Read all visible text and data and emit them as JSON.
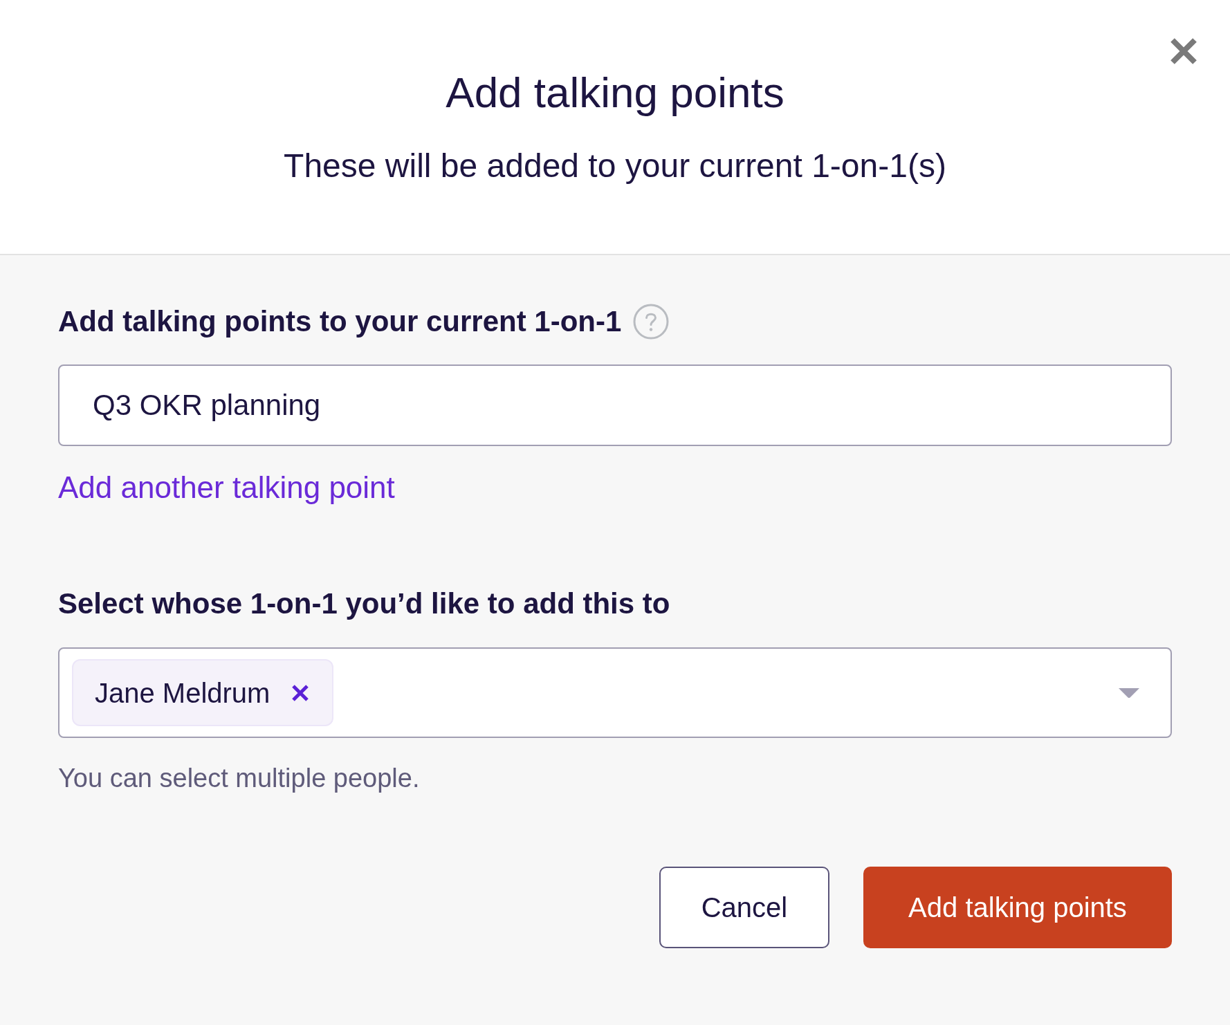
{
  "dialog": {
    "title": "Add talking points",
    "subtitle": "These will be added to your current 1-on-1(s)"
  },
  "talking_points": {
    "label": "Add talking points to your current 1-on-1",
    "items": [
      {
        "value": "Q3 OKR planning"
      }
    ],
    "add_link": "Add another talking point"
  },
  "people": {
    "label": "Select whose 1-on-1 you’d like to add this to",
    "selected": [
      {
        "name": "Jane Meldrum"
      }
    ],
    "hint": "You can select multiple people."
  },
  "buttons": [
    {
      "label": "Cancel",
      "kind": "secondary"
    },
    {
      "label": "Add talking points",
      "kind": "primary"
    }
  ]
}
